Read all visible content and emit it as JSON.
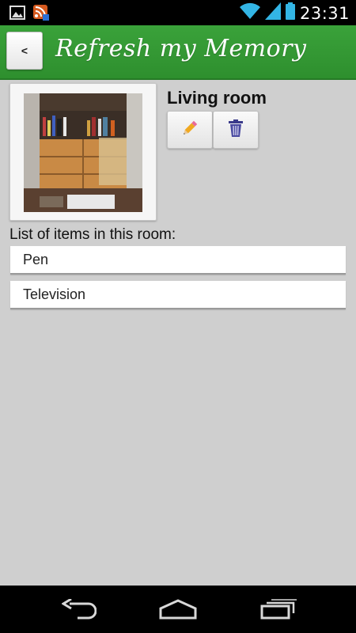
{
  "status_bar": {
    "time": "23:31",
    "left_icons": [
      "gallery-notification-icon",
      "rss-notification-icon"
    ],
    "right_icons": [
      "wifi-icon",
      "signal-icon",
      "battery-icon"
    ]
  },
  "app_bar": {
    "back_label": "<",
    "title": "Refresh my Memory",
    "color": "#36a036"
  },
  "room": {
    "name": "Living room",
    "edit_icon": "pencil-icon",
    "delete_icon": "trash-icon"
  },
  "items_section": {
    "label": "List of items in this room:",
    "items": [
      {
        "label": "Pen"
      },
      {
        "label": "Television"
      }
    ]
  },
  "nav_bar": {
    "buttons": [
      "back-nav-icon",
      "home-nav-icon",
      "recents-nav-icon"
    ]
  }
}
